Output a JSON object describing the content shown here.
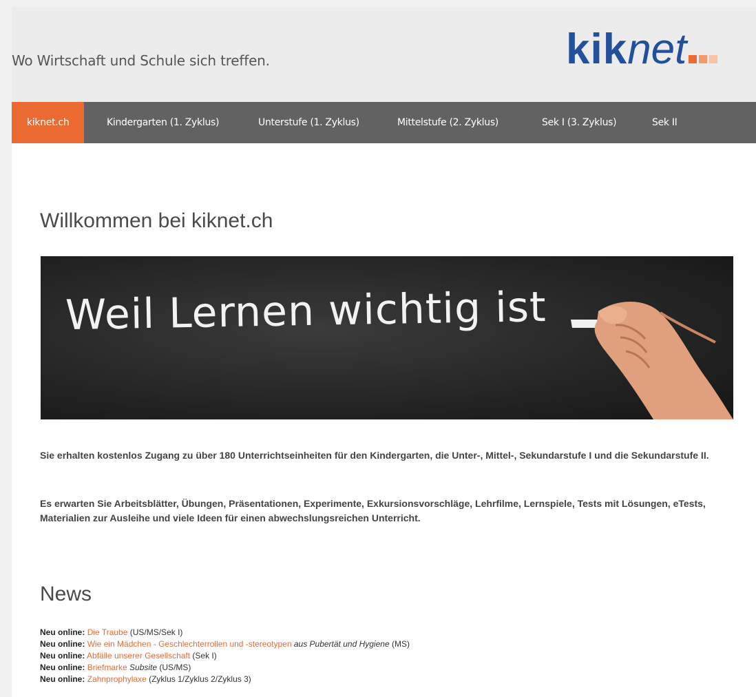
{
  "header": {
    "tagline": "Wo Wirtschaft und Schule sich treffen.",
    "logo_kik": "kik",
    "logo_net": "net",
    "logo_dot_colors": [
      "#ea6a31",
      "#f29a6a",
      "#f7c3a4"
    ]
  },
  "nav": {
    "items": [
      {
        "label": "kiknet.ch",
        "active": true
      },
      {
        "label": "Kindergarten (1. Zyklus)"
      },
      {
        "label": "Unterstufe (1. Zyklus)"
      },
      {
        "label": "Mittelstufe (2. Zyklus)"
      },
      {
        "label": "Sek I (3. Zyklus)"
      },
      {
        "label": "Sek II"
      }
    ]
  },
  "main": {
    "title": "Willkommen bei kiknet.ch",
    "banner_text": "Weil Lernen wichtig ist",
    "intro_1": "Sie erhalten kostenlos Zugang zu über 180 Unterrichtseinheiten für den Kindergarten, die Unter-, Mittel-, Sekundarstufe I und die Sekundarstufe II.",
    "intro_2": "Es erwarten Sie Arbeitsblätter, Übungen, Präsentationen, Experimente, Exkursionsvorschläge, Lehrfilme, Lernspiele, Tests mit Lösungen, eTests, Materialien zur Ausleihe und viele Ideen für einen abwechslungsreichen Unterricht."
  },
  "news": {
    "title": "News",
    "prefix": "Neu online:",
    "items": [
      {
        "link": "Die Traube",
        "italic": "",
        "suffix": " (US/MS/Sek I)"
      },
      {
        "link": "Wie ein Mädchen - Geschlechterrollen und -stereotypen",
        "italic": " aus Pubertät und Hygiene",
        "suffix": " (MS)"
      },
      {
        "link": "Abfälle unserer Gesellschaft",
        "italic": "",
        "suffix": " (Sek I)"
      },
      {
        "link": "Briefmarke",
        "italic": " Subsite",
        "suffix": " (US/MS)"
      },
      {
        "link": "Zahnprophylaxe",
        "italic": "",
        "suffix": " (Zyklus 1/Zyklus 2/Zyklus 3)"
      }
    ]
  },
  "colors": {
    "accent": "#ea6a31",
    "nav_bg": "#626262",
    "logo_blue": "#22509b"
  }
}
